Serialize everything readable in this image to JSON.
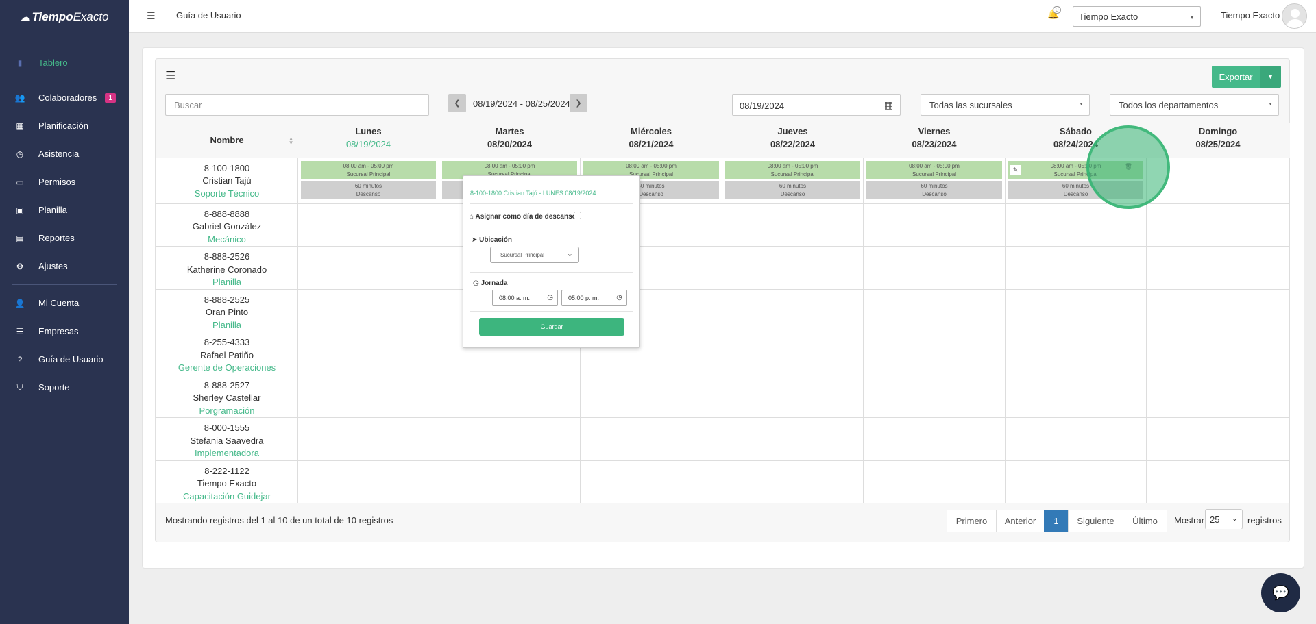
{
  "brand": {
    "name_bold": "Tiempo",
    "name_light": "Exacto"
  },
  "sidebar": {
    "items": [
      {
        "label": "Tablero",
        "icon": "bar-chart-icon",
        "active": true
      },
      {
        "label": "Colaboradores",
        "icon": "users-icon",
        "badge": "1"
      },
      {
        "label": "Planificación",
        "icon": "calendar-icon"
      },
      {
        "label": "Asistencia",
        "icon": "clock-icon"
      },
      {
        "label": "Permisos",
        "icon": "inbox-icon"
      },
      {
        "label": "Planilla",
        "icon": "money-icon"
      },
      {
        "label": "Reportes",
        "icon": "file-icon"
      },
      {
        "label": "Ajustes",
        "icon": "gear-icon"
      },
      {
        "label": "Mi Cuenta",
        "icon": "user-icon"
      },
      {
        "label": "Empresas",
        "icon": "sliders-icon"
      },
      {
        "label": "Guía de Usuario",
        "icon": "question-icon"
      },
      {
        "label": "Soporte",
        "icon": "shield-icon"
      }
    ]
  },
  "topbar": {
    "title": "Guía de Usuario",
    "notifications": "0",
    "company_selected": "Tiempo Exacto",
    "user_name": "Tiempo Exacto"
  },
  "toolbar": {
    "export_label": "Exportar",
    "search_placeholder": "Buscar",
    "week_range": "08/19/2024 - 08/25/2024",
    "date_value": "08/19/2024",
    "branch_select": "Todas las sucursales",
    "dept_select": "Todos los departamentos"
  },
  "table": {
    "name_header": "Nombre",
    "days": [
      {
        "day": "Lunes",
        "date": "08/19/2024"
      },
      {
        "day": "Martes",
        "date": "08/20/2024"
      },
      {
        "day": "Miércoles",
        "date": "08/21/2024"
      },
      {
        "day": "Jueves",
        "date": "08/22/2024"
      },
      {
        "day": "Viernes",
        "date": "08/23/2024"
      },
      {
        "day": "Sábado",
        "date": "08/24/2024"
      },
      {
        "day": "Domingo",
        "date": "08/25/2024"
      }
    ],
    "shift": {
      "hours": "08:00 am - 05:00 pm",
      "location": "Sucursal Principal",
      "break_minutes": "60 minutos",
      "break_label": "Descanso"
    },
    "employees": [
      {
        "code": "8-100-1800",
        "name": "Cristian Tajú",
        "role": "Soporte Técnico"
      },
      {
        "code": "8-888-8888",
        "name": "Gabriel González",
        "role": "Mecánico"
      },
      {
        "code": "8-888-2526",
        "name": "Katherine Coronado",
        "role": "Planilla"
      },
      {
        "code": "8-888-2525",
        "name": "Oran Pinto",
        "role": "Planilla"
      },
      {
        "code": "8-255-4333",
        "name": "Rafael Patiño",
        "role": "Gerente de Operaciones"
      },
      {
        "code": "8-888-2527",
        "name": "Sherley Castellar",
        "role": "Porgramación"
      },
      {
        "code": "8-000-1555",
        "name": "Stefania Saavedra",
        "role": "Implementadora"
      },
      {
        "code": "8-222-1122",
        "name": "Tiempo Exacto",
        "role": "Capacitación Guidejar"
      }
    ]
  },
  "footer": {
    "info": "Mostrando registros del 1 al 10 de un total de 10 registros",
    "pages": [
      "Primero",
      "Anterior",
      "1",
      "Siguiente",
      "Último"
    ],
    "show_label": "Mostrar",
    "show_value": "25",
    "records_label": "registros"
  },
  "popover": {
    "title": "8-100-1800 Cristian Tajú - LUNES 08/19/2024",
    "rest_day_label": "Asignar como día de descanso",
    "location_label": "Ubicación",
    "location_value": "Sucursal Principal",
    "shift_label": "Jornada",
    "start_time": "08:00 a. m.",
    "end_time": "05:00 p. m.",
    "save_label": "Guardar"
  },
  "colors": {
    "sidebar_bg": "#2a3350",
    "accent": "#45b98a",
    "primary": "#337ab7"
  }
}
